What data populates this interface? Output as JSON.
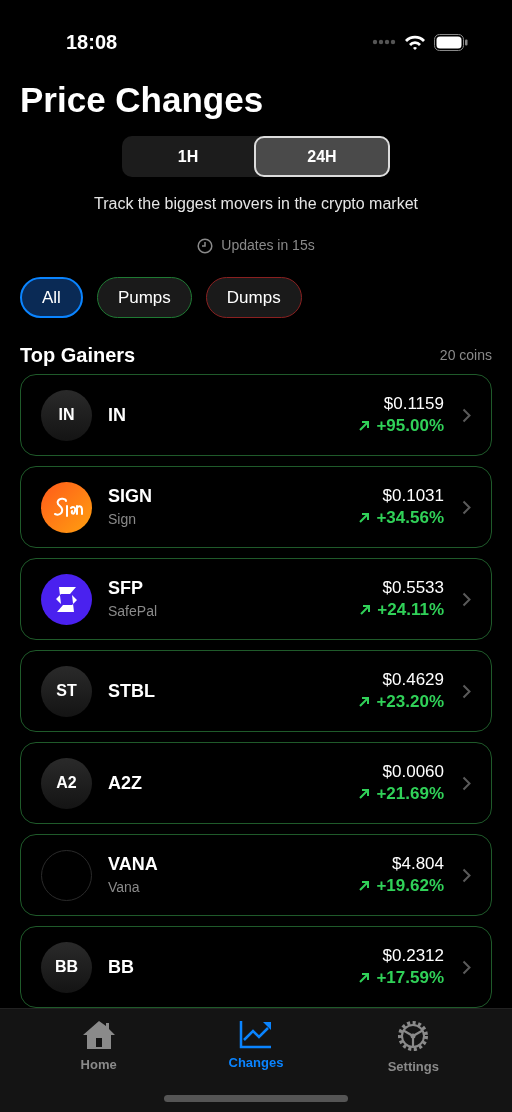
{
  "status_bar": {
    "time": "18:08"
  },
  "title": "Price Changes",
  "periods": [
    {
      "label": "1H",
      "selected": false
    },
    {
      "label": "24H",
      "selected": true
    }
  ],
  "subtitle": "Track the biggest movers in the crypto market",
  "updates": "Updates in 15s",
  "filters": [
    {
      "label": "All",
      "selected": true,
      "color": "#0a84ff"
    },
    {
      "label": "Pumps",
      "selected": false,
      "color": "#1f7a33"
    },
    {
      "label": "Dumps",
      "selected": false,
      "color": "#8a2020"
    }
  ],
  "section": {
    "title": "Top Gainers",
    "count": "20 coins"
  },
  "coins": [
    {
      "symbol": "IN",
      "avatar": {
        "kind": "initials",
        "text": "IN"
      },
      "price": "$0.1159",
      "change": "+95.00%"
    },
    {
      "symbol": "SIGN",
      "name": "Sign",
      "avatar": {
        "kind": "sign-logo"
      },
      "price": "$0.1031",
      "change": "+34.56%"
    },
    {
      "symbol": "SFP",
      "name": "SafePal",
      "avatar": {
        "kind": "safepal-logo"
      },
      "price": "$0.5533",
      "change": "+24.11%"
    },
    {
      "symbol": "STBL",
      "avatar": {
        "kind": "initials",
        "text": "ST"
      },
      "price": "$0.4629",
      "change": "+23.20%"
    },
    {
      "symbol": "A2Z",
      "avatar": {
        "kind": "initials",
        "text": "A2"
      },
      "price": "$0.0060",
      "change": "+21.69%"
    },
    {
      "symbol": "VANA",
      "name": "Vana",
      "avatar": {
        "kind": "empty"
      },
      "price": "$4.804",
      "change": "+19.62%"
    },
    {
      "symbol": "BB",
      "avatar": {
        "kind": "initials",
        "text": "BB"
      },
      "price": "$0.2312",
      "change": "+17.59%"
    }
  ],
  "tab_bar": [
    {
      "kind": "home",
      "label": "Home",
      "selected": false
    },
    {
      "kind": "changes",
      "label": "Changes",
      "selected": true
    },
    {
      "kind": "settings",
      "label": "Settings",
      "selected": false
    }
  ]
}
